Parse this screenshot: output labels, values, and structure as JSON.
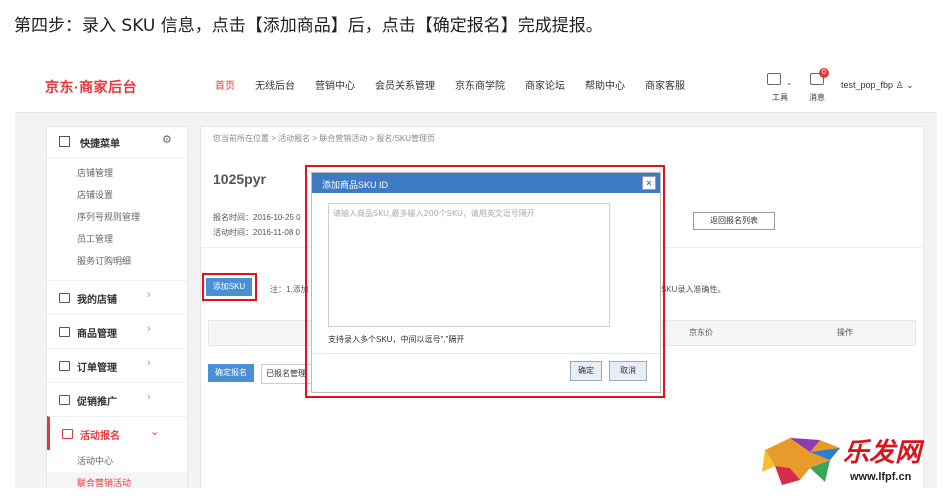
{
  "caption": "第四步：录入 SKU 信息，点击【添加商品】后，点击【确定报名】完成提报。",
  "header": {
    "logo": "京东·商家后台",
    "nav": [
      "首页",
      "无线后台",
      "营销中心",
      "会员关系管理",
      "京东商学院",
      "商家论坛",
      "帮助中心",
      "商家客服"
    ],
    "tools_label": "工具",
    "messages_label": "消息",
    "messages_count": "0",
    "username": "test_pop_fbp"
  },
  "sidebar": {
    "quick_menu": "快捷菜单",
    "quick_items": [
      "店铺管理",
      "店铺设置",
      "序列号规则管理",
      "员工管理",
      "服务订购明细"
    ],
    "sections": [
      "我的店铺",
      "商品管理",
      "订单管理",
      "促销推广",
      "活动报名"
    ],
    "activity_items": [
      "活动中心",
      "联合营销活动"
    ]
  },
  "main": {
    "breadcrumb": "您当前所在位置 > 活动报名 > 联合营销活动 > 报名/SKU管理页",
    "activity_name": "1025pyr",
    "signup_time": "报名时间：2016-10-25 0",
    "activity_time": "活动时间：2016-11-08 0",
    "back_button": "返回报名列表",
    "add_sku_button": "添加SKU",
    "note": "注：1.添加",
    "note_tail": "SKU录入准确性。",
    "columns": [
      "京东价",
      "操作"
    ],
    "confirm_button": "确定报名",
    "registered_button": "已报名管理"
  },
  "modal": {
    "title": "添加商品SKU ID",
    "placeholder": "请输入商品SKU,最多输入200个SKU，请用英文逗号隔开",
    "hint": "支持录入多个SKU，中间以逗号\",\"隔开",
    "ok": "确定",
    "cancel": "取消"
  },
  "watermark": {
    "text": "乐发网",
    "url": "www.lfpf.cn"
  },
  "colors": {
    "brand_red": "#e4393c",
    "highlight_red": "#e4101c",
    "button_blue": "#4a90d6",
    "modal_title": "#3f7bc4"
  }
}
